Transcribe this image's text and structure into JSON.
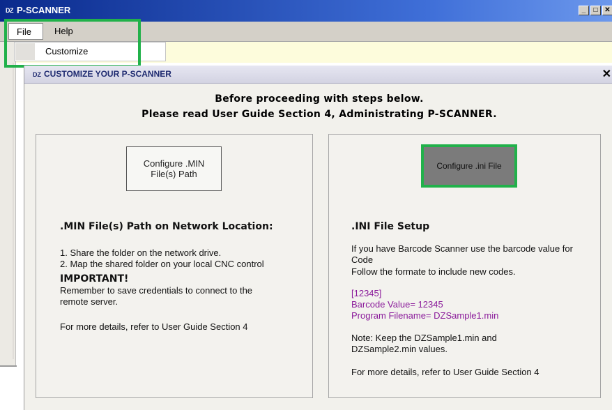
{
  "main_window": {
    "logo": "DZ",
    "title": "P-SCANNER",
    "controls": {
      "minimize": "_",
      "maximize": "□",
      "close": "✕"
    }
  },
  "menu": {
    "file": "File",
    "help": "Help",
    "dropdown_item": "Customize"
  },
  "dialog": {
    "logo": "DZ",
    "title": "CUSTOMIZE YOUR P-SCANNER",
    "close": "✕",
    "intro_line1": "Before proceeding with steps below.",
    "intro_line2": "Please read User Guide Section 4, Administrating P-SCANNER.",
    "left": {
      "button_label": "Configure .MIN File(s) Path",
      "heading": ".MIN File(s) Path on Network Location:",
      "step1": "1. Share the folder on the network drive.",
      "step2": "2. Map the shared folder on your local CNC control",
      "important_heading": "IMPORTANT!",
      "important_text": "Remember to save credentials to connect to the remote server.",
      "more": "For more details, refer to User Guide Section 4"
    },
    "right": {
      "button_label": "Configure .ini File",
      "heading": ".INI File Setup",
      "para1": "If you have Barcode Scanner use the barcode value for Code",
      "para2": "Follow the formate to include new codes.",
      "code_line1": "[12345]",
      "code_line2": "Barcode Value= 12345",
      "code_line3": "Program Filename= DZSample1.min",
      "note": "Note: Keep the DZSample1.min and DZSample2.min values.",
      "more": "For more details, refer to User Guide Section 4"
    }
  },
  "colors": {
    "highlight": "#21b14a",
    "title_bar": "#0a2a8c",
    "code_text": "#8a1a9a"
  }
}
